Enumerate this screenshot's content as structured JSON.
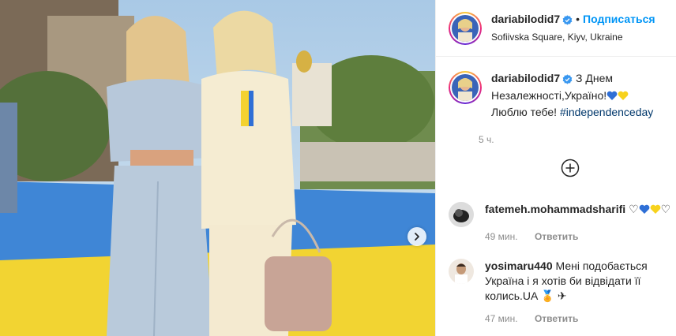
{
  "post": {
    "username": "dariabilodid7",
    "follow_label": "Подписаться",
    "dot": "•",
    "location": "Sofiivska Square, Kiyv, Ukraine",
    "caption_text": "З Днем Незалежності,Україно!",
    "caption_after": "Люблю тебе!",
    "hashtag": "#independenceday",
    "time_ago": "5 ч."
  },
  "comments": [
    {
      "username": "fatemeh.mohammadsharifi",
      "text_prefix": "♡",
      "text_suffix": "♡",
      "time": "49 мин.",
      "reply_label": "Ответить"
    },
    {
      "username": "yosimaru440",
      "text": "Мені подобається Україна і я хотів би відвідати її колись.UA",
      "time": "47 мин.",
      "reply_label": "Ответить"
    }
  ],
  "colors": {
    "link_blue": "#0095f6",
    "hashtag": "#00376b",
    "muted": "#8e8e8e",
    "heart_blue": "#2f6fd6",
    "heart_yellow": "#f7d21d"
  }
}
